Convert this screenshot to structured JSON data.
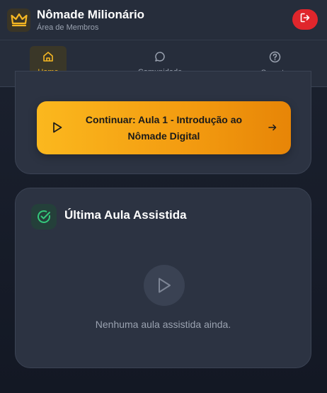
{
  "header": {
    "title": "Nômade Milionário",
    "subtitle": "Área de Membros",
    "logo_icon": "crown-icon",
    "logout_icon": "logout-icon",
    "accent": "#f5b723",
    "logout_color": "#e0262c"
  },
  "nav": {
    "items": [
      {
        "label": "Home",
        "icon": "home-icon",
        "active": true
      },
      {
        "label": "Comunidade",
        "icon": "chat-icon",
        "active": false
      },
      {
        "label": "Suporte",
        "icon": "help-icon",
        "active": false
      }
    ]
  },
  "continue": {
    "label": "Continuar: Aula 1 - Introdução ao Nômade Digital",
    "play_icon": "play-icon",
    "arrow_icon": "arrow-right-icon"
  },
  "last_lesson": {
    "title": "Última Aula Assistida",
    "icon": "check-circle-icon",
    "empty_icon": "play-icon",
    "empty_text": "Nenhuma aula assistida ainda."
  }
}
